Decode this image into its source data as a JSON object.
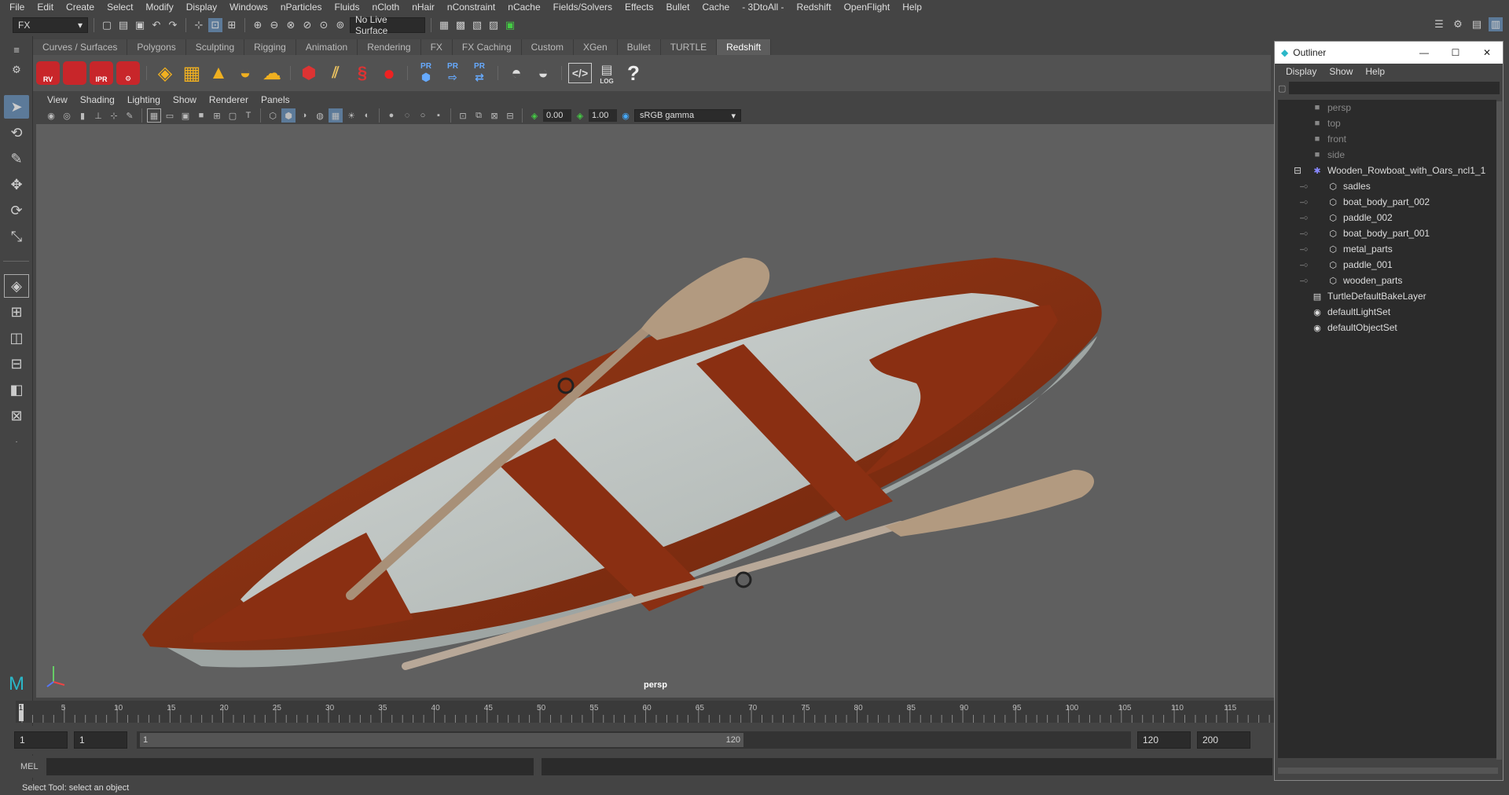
{
  "menubar": [
    "File",
    "Edit",
    "Create",
    "Select",
    "Modify",
    "Display",
    "Windows",
    "nParticles",
    "Fluids",
    "nCloth",
    "nHair",
    "nConstraint",
    "nCache",
    "Fields/Solvers",
    "Effects",
    "Bullet",
    "Cache",
    "- 3DtoAll -",
    "Redshift",
    "OpenFlight",
    "Help"
  ],
  "statusline": {
    "menu_set": "FX",
    "live_surface": "No Live Surface"
  },
  "shelf_tabs": [
    "Curves / Surfaces",
    "Polygons",
    "Sculpting",
    "Rigging",
    "Animation",
    "Rendering",
    "FX",
    "FX Caching",
    "Custom",
    "XGen",
    "Bullet",
    "TURTLE",
    "Redshift"
  ],
  "shelf_active": "Redshift",
  "shelf_icons": {
    "rv": "RV",
    "ipr": "IPR",
    "pr": "PR",
    "log": "LOG",
    "help": "?"
  },
  "viewport": {
    "menu": [
      "View",
      "Shading",
      "Lighting",
      "Show",
      "Renderer",
      "Panels"
    ],
    "exposure": "0.00",
    "gamma": "1.00",
    "color_space": "sRGB gamma",
    "camera": "persp"
  },
  "timeline": {
    "ticks": [
      "5",
      "10",
      "15",
      "20",
      "25",
      "30",
      "35",
      "40",
      "45",
      "50",
      "55",
      "60",
      "65",
      "70",
      "75",
      "80",
      "85",
      "90",
      "95",
      "100",
      "105",
      "110",
      "115"
    ],
    "current": "1"
  },
  "range": {
    "start": "1",
    "current": "1",
    "slider_start": "1",
    "slider_end": "120",
    "end": "120",
    "max": "200"
  },
  "cmdline": {
    "label": "MEL"
  },
  "helpline": "Select Tool: select an object",
  "outliner": {
    "title": "Outliner",
    "menu": [
      "Display",
      "Show",
      "Help"
    ],
    "items": [
      {
        "label": "persp",
        "dim": true,
        "depth": 1,
        "icon": "cam"
      },
      {
        "label": "top",
        "dim": true,
        "depth": 1,
        "icon": "cam"
      },
      {
        "label": "front",
        "dim": true,
        "depth": 1,
        "icon": "cam"
      },
      {
        "label": "side",
        "dim": true,
        "depth": 1,
        "icon": "cam"
      },
      {
        "label": "Wooden_Rowboat_with_Oars_ncl1_1",
        "dim": false,
        "depth": 1,
        "icon": "group",
        "expand": "minus"
      },
      {
        "label": "sadles",
        "dim": false,
        "depth": 2,
        "icon": "mesh"
      },
      {
        "label": "boat_body_part_002",
        "dim": false,
        "depth": 2,
        "icon": "mesh"
      },
      {
        "label": "paddle_002",
        "dim": false,
        "depth": 2,
        "icon": "mesh"
      },
      {
        "label": "boat_body_part_001",
        "dim": false,
        "depth": 2,
        "icon": "mesh"
      },
      {
        "label": "metal_parts",
        "dim": false,
        "depth": 2,
        "icon": "mesh"
      },
      {
        "label": "paddle_001",
        "dim": false,
        "depth": 2,
        "icon": "mesh"
      },
      {
        "label": "wooden_parts",
        "dim": false,
        "depth": 2,
        "icon": "mesh"
      },
      {
        "label": "TurtleDefaultBakeLayer",
        "dim": false,
        "depth": 1,
        "icon": "layer"
      },
      {
        "label": "defaultLightSet",
        "dim": false,
        "depth": 1,
        "icon": "set"
      },
      {
        "label": "defaultObjectSet",
        "dim": false,
        "depth": 1,
        "icon": "set"
      }
    ]
  },
  "colors": {
    "redshift": "#c8262a",
    "wood": "#8a2f12",
    "deck": "#c9cfcc",
    "oar": "#b29a80",
    "viewport_bg": "#5f5f5f"
  }
}
